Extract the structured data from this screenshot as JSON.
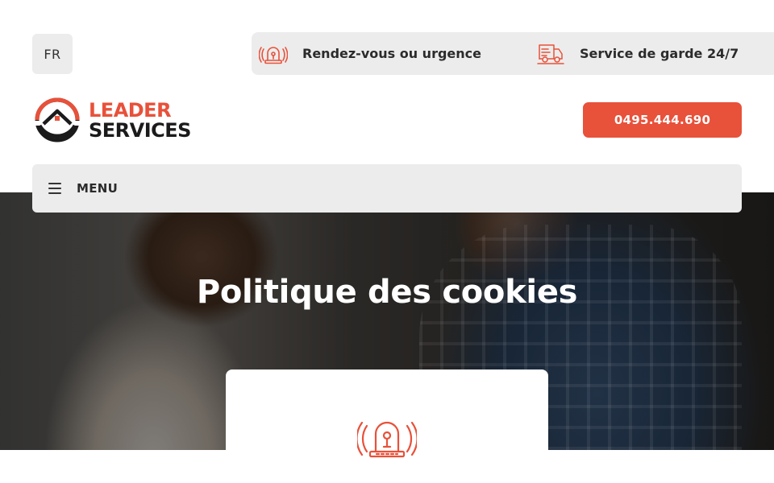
{
  "language": {
    "current": "FR"
  },
  "top_bar": {
    "items": [
      {
        "label": "Rendez-vous ou urgence",
        "icon": "siren-icon"
      },
      {
        "label": "Service de garde 24/7",
        "icon": "delivery-truck-icon"
      }
    ]
  },
  "logo": {
    "line1": "LEADER",
    "line2": "SERVICES"
  },
  "phone": {
    "label": "0495.444.690"
  },
  "menu": {
    "label": "MENU"
  },
  "hero": {
    "title": "Politique des cookies"
  },
  "card": {
    "icon": "siren-icon"
  },
  "colors": {
    "accent": "#e8513a",
    "bar_bg": "#ececec",
    "text_dark": "#2b2b2b",
    "white": "#ffffff"
  }
}
